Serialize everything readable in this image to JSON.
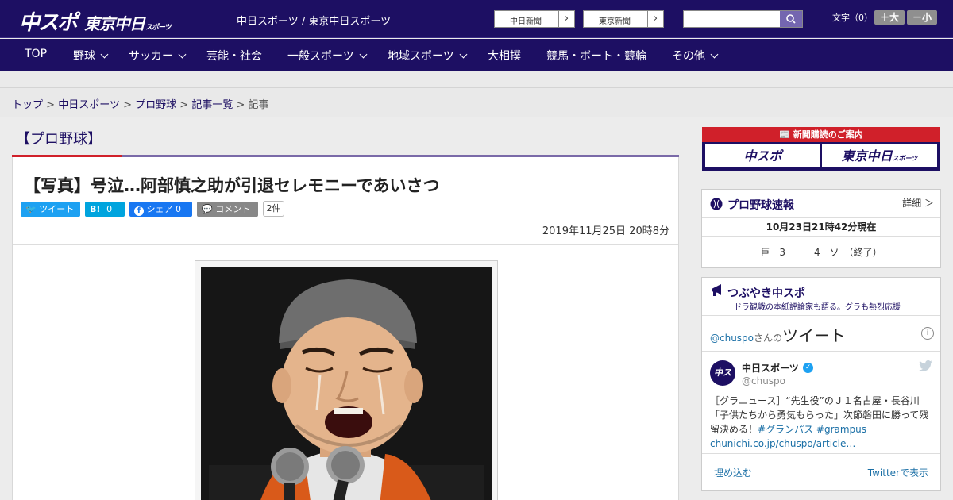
{
  "header": {
    "logo_main": "中スポ",
    "logo_sub": "東京中日",
    "logo_sub_small": "スポーツ",
    "tagline": "中日スポーツ / 東京中日スポーツ",
    "links": [
      {
        "label": "中日新聞"
      },
      {
        "label": "東京新聞"
      }
    ],
    "search": {
      "placeholder": ""
    },
    "font_size_label": "文字（0）",
    "font_larger": "＋大",
    "font_smaller": "－小"
  },
  "nav": {
    "items": [
      {
        "label": "TOP",
        "dropdown": false
      },
      {
        "label": "野球",
        "dropdown": true
      },
      {
        "label": "サッカー",
        "dropdown": true
      },
      {
        "label": "芸能・社会",
        "dropdown": false
      },
      {
        "label": "一般スポーツ",
        "dropdown": true
      },
      {
        "label": "地域スポーツ",
        "dropdown": true
      },
      {
        "label": "大相撲",
        "dropdown": false
      },
      {
        "label": "競馬・ボート・競輪",
        "dropdown": false
      },
      {
        "label": "その他",
        "dropdown": true
      }
    ]
  },
  "breadcrumb": {
    "items": [
      "トップ",
      "中日スポーツ",
      "プロ野球",
      "記事一覧"
    ],
    "current": "記事",
    "separator": ">"
  },
  "category": "【プロ野球】",
  "article": {
    "title": "【写真】号泣…阿部慎之助が引退セレモニーであいさつ",
    "share": {
      "tweet": "ツイート",
      "hatena_label": "B!",
      "hatena_count": "0",
      "facebook": "シェア",
      "facebook_count": "0",
      "comment": "コメント",
      "comment_count": "2件"
    },
    "date": "2019年11月25日 20時8分"
  },
  "sidebar": {
    "subscribe": {
      "title": "新聞購読のご案内",
      "left": "中スポ",
      "right": "東京中日",
      "right_small": "スポーツ"
    },
    "score": {
      "title": "プロ野球速報",
      "more": "詳細 ＞",
      "timestamp": "10月23日21時42分現在",
      "line": "巨　3　－　4　ソ　（終了）"
    },
    "twitter": {
      "title": "つぶやき中スポ",
      "subtitle": "ドラ観戦の本紙評論家も語る。グラも熱烈応援",
      "handle_prefix": "@chuspo",
      "san_no": "さんの",
      "tweet_word": "ツイート",
      "user_name": "中日スポーツ",
      "user_handle": "@chuspo",
      "avatar_text": "中スポ",
      "tweet_text": "［グラニュース］“先生役”のＪ１名古屋・長谷川「子供たちから勇気もらった」次節磐田に勝って残留決める！",
      "hashtag1": "#グランパス",
      "hashtag2": "#grampus",
      "link": "chunichi.co.jp/chuspo/article…",
      "embed": "埋め込む",
      "view_on": "Twitterで表示"
    }
  },
  "colors": {
    "brand": "#1d0f63",
    "accent_red": "#d0202a",
    "twitter": "#1da1f2",
    "facebook": "#1877f2",
    "hatena": "#00a4de"
  }
}
